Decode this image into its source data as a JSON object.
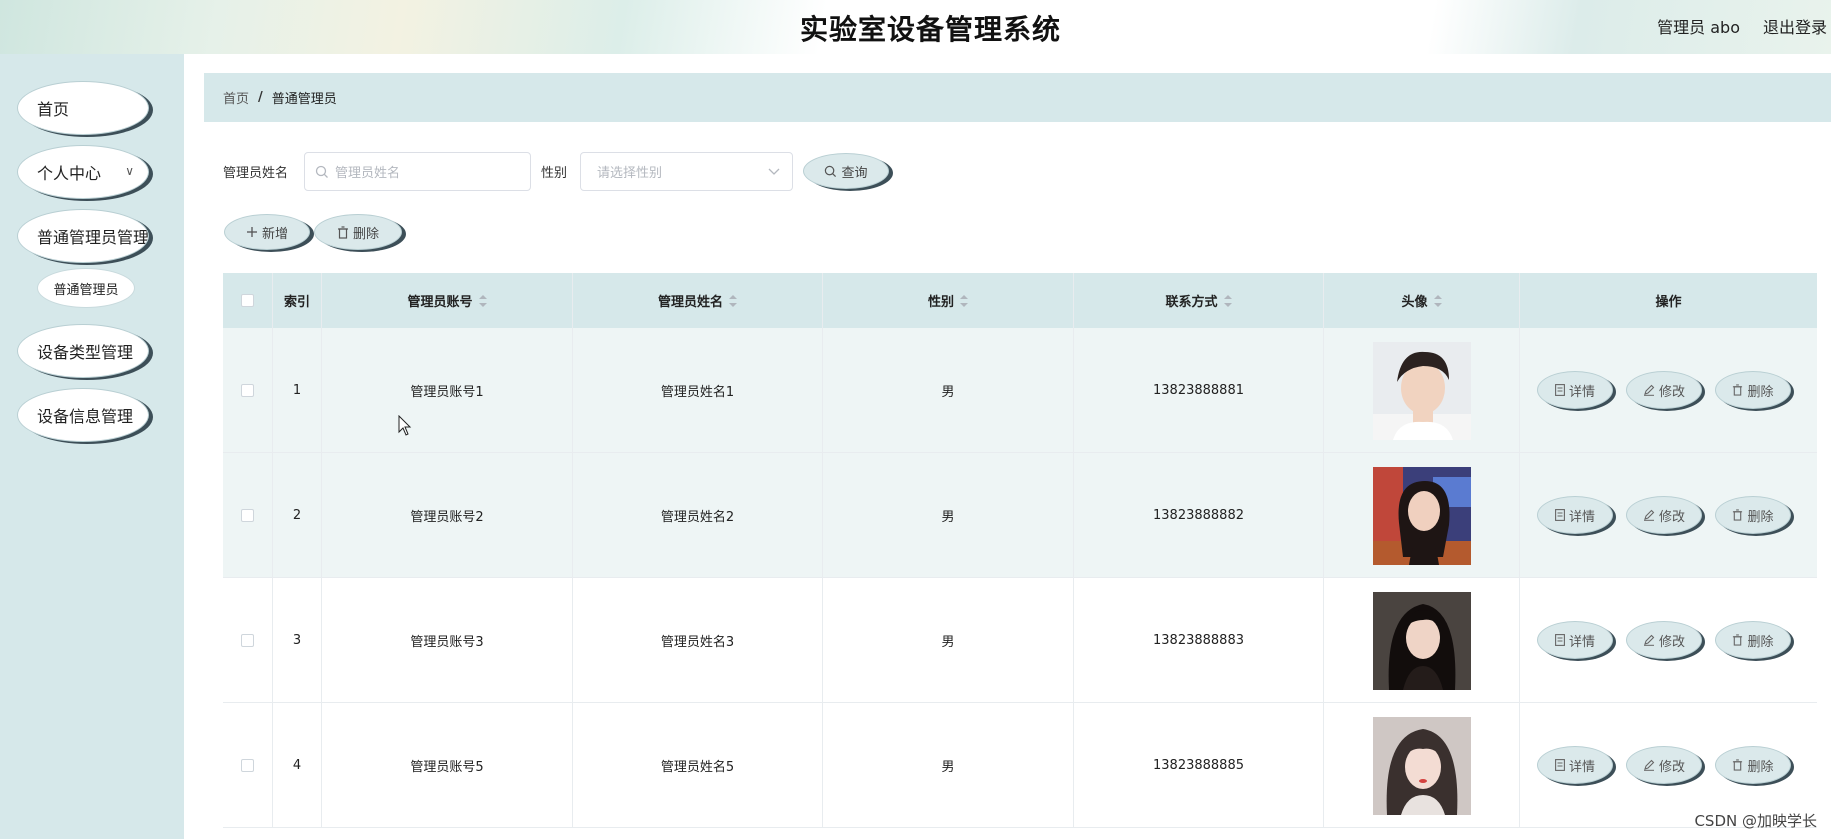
{
  "header": {
    "title": "实验室设备管理系统",
    "user": "管理员 abo",
    "logout": "退出登录"
  },
  "sidebar": {
    "items": [
      {
        "label": "首页"
      },
      {
        "label": "个人中心"
      },
      {
        "label": "普通管理员管理"
      },
      {
        "label": "设备类型管理"
      },
      {
        "label": "设备信息管理"
      }
    ],
    "sub_item": "普通管理员"
  },
  "breadcrumb": {
    "home": "首页",
    "separator": "/",
    "current": "普通管理员"
  },
  "search": {
    "name_label": "管理员姓名",
    "name_placeholder": "管理员姓名",
    "gender_label": "性别",
    "gender_placeholder": "请选择性别",
    "query_label": "查询"
  },
  "actions": {
    "add_label": "新增",
    "delete_label": "删除"
  },
  "table": {
    "columns": [
      "索引",
      "管理员账号",
      "管理员姓名",
      "性别",
      "联系方式",
      "头像",
      "操作"
    ],
    "rows": [
      {
        "index": "1",
        "account": "管理员账号1",
        "name": "管理员姓名1",
        "gender": "男",
        "phone": "13823888881"
      },
      {
        "index": "2",
        "account": "管理员账号2",
        "name": "管理员姓名2",
        "gender": "男",
        "phone": "13823888882"
      },
      {
        "index": "3",
        "account": "管理员账号3",
        "name": "管理员姓名3",
        "gender": "男",
        "phone": "13823888883"
      },
      {
        "index": "4",
        "account": "管理员账号5",
        "name": "管理员姓名5",
        "gender": "男",
        "phone": "13823888885"
      }
    ],
    "row_actions": {
      "detail": "详情",
      "edit": "修改",
      "delete": "删除"
    }
  },
  "watermark": "CSDN @加映学长",
  "colors": {
    "sidebar_bg": "#d6e8ea",
    "pill_shadow": "#3d4f58",
    "button_bg": "#dbe9eb"
  }
}
